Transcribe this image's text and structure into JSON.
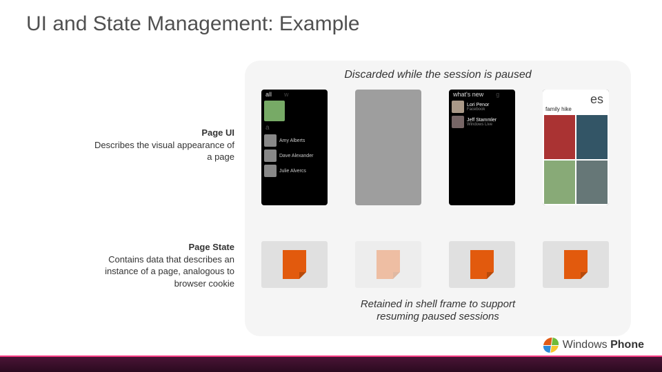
{
  "title": "UI and State Management: Example",
  "panel": {
    "top_caption": "Discarded while the session is paused",
    "bottom_caption_line1": "Retained in shell frame to support",
    "bottom_caption_line2": "resuming paused sessions"
  },
  "left": {
    "page_ui": {
      "heading": "Page UI",
      "desc": "Describes the visual appearance of a page"
    },
    "page_state": {
      "heading": "Page State",
      "desc": "Contains data that describes an instance of a page, analogous to browser cookie"
    }
  },
  "phones": [
    {
      "tabs": [
        "all",
        "w"
      ],
      "contacts": [
        "Amy Alberts",
        "Dave Alexander",
        "Julie Alvercs"
      ]
    },
    {
      "placeholder": true
    },
    {
      "tabs": [
        "what's new",
        "g"
      ],
      "feed": [
        {
          "name": "Lori Penor",
          "sub": "Facebook"
        },
        {
          "name": "Jeff Stammler",
          "sub": "Windows Live"
        }
      ]
    },
    {
      "header_right": "es",
      "album_title": "family hike"
    }
  ],
  "brand": {
    "left": "Windows",
    "right": "Phone"
  }
}
